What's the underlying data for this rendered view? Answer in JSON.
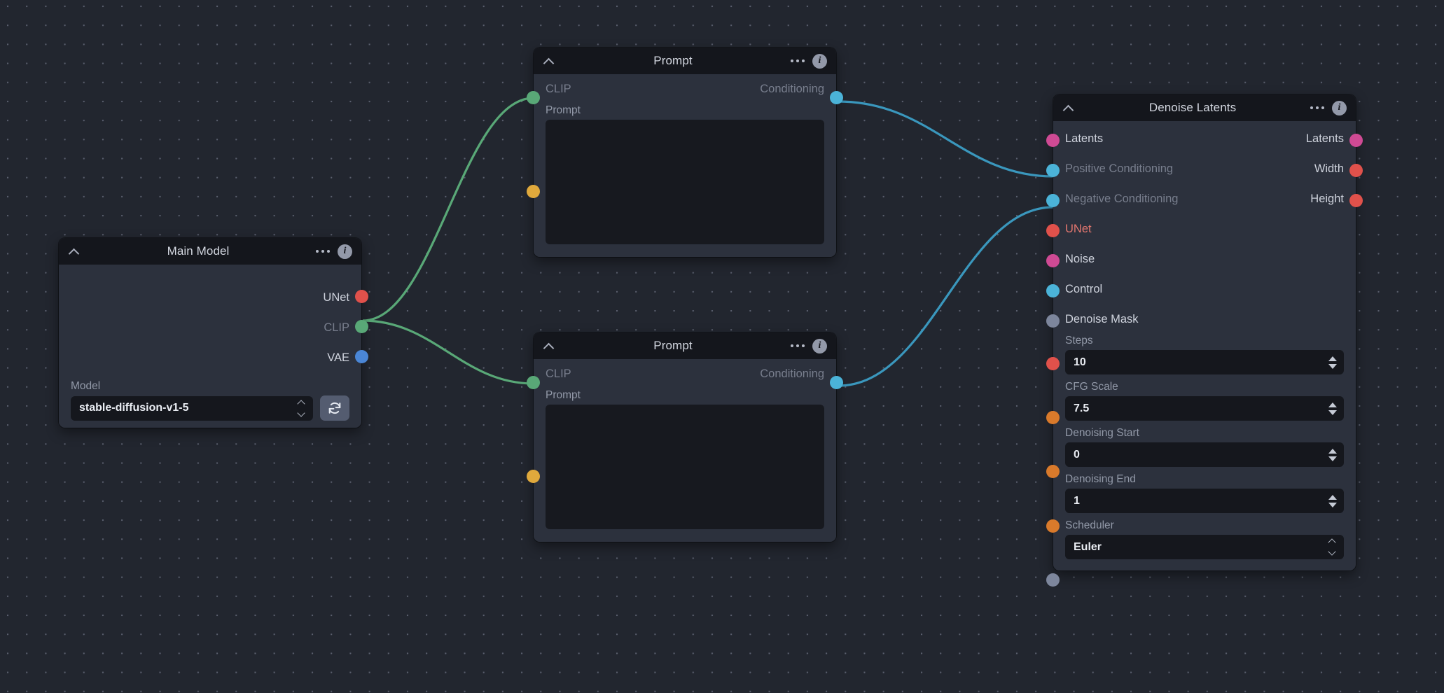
{
  "canvas": {
    "background_color": "#22262f",
    "dot_color": "#5a5f6e"
  },
  "colors": {
    "unet_red": "#e0514b",
    "clip_green": "#59a877",
    "vae_blue": "#4a86d6",
    "conditioning_blue": "#4bb3d8",
    "latents_pink": "#cf4a94",
    "prompt_amber": "#e0a93c",
    "mask_grey": "#7d869c",
    "number_orange": "#d97a2b",
    "steps_red": "#e0514b",
    "required_label": "#e3766f"
  },
  "icons": {
    "collapse": "chevron-up-icon",
    "menu": "dots-menu-icon",
    "info": "info-icon",
    "refresh": "refresh-icon",
    "stepper": "stepper-icon",
    "select_chevron": "chevron-up-down-icon"
  },
  "nodes": {
    "main_model": {
      "title": "Main Model",
      "outputs": [
        {
          "label": "UNet",
          "color": "#e0514b",
          "dim": false
        },
        {
          "label": "CLIP",
          "color": "#59a877",
          "dim": true
        },
        {
          "label": "VAE",
          "color": "#4a86d6",
          "dim": false
        }
      ],
      "model_field": {
        "label": "Model",
        "value": "stable-diffusion-v1-5",
        "refresh_title": "Refresh models"
      }
    },
    "prompt_positive": {
      "title": "Prompt",
      "input_label": "CLIP",
      "output_label": "Conditioning",
      "prompt_label": "Prompt",
      "prompt_value": "",
      "prompt_placeholder": ""
    },
    "prompt_negative": {
      "title": "Prompt",
      "input_label": "CLIP",
      "output_label": "Conditioning",
      "prompt_label": "Prompt",
      "prompt_value": "",
      "prompt_placeholder": ""
    },
    "denoise_latents": {
      "title": "Denoise Latents",
      "top_rows": [
        {
          "in_label": "Latents",
          "in_color": "#cf4a94",
          "in_dim": false,
          "in_req": false,
          "out_label": "Latents",
          "out_color": "#cf4a94"
        },
        {
          "in_label": "Positive Conditioning",
          "in_color": "#4bb3d8",
          "in_dim": true,
          "in_req": false,
          "out_label": "Width",
          "out_color": "#e0514b"
        },
        {
          "in_label": "Negative Conditioning",
          "in_color": "#4bb3d8",
          "in_dim": true,
          "in_req": false,
          "out_label": "Height",
          "out_color": "#e0514b"
        }
      ],
      "inputs": [
        {
          "label": "UNet",
          "color": "#e0514b",
          "dim": false,
          "req": true
        },
        {
          "label": "Noise",
          "color": "#cf4a94",
          "dim": false,
          "req": false
        },
        {
          "label": "Control",
          "color": "#4bb3d8",
          "dim": false,
          "req": false
        },
        {
          "label": "Denoise Mask",
          "color": "#7d869c",
          "dim": false,
          "req": false
        }
      ],
      "fields": [
        {
          "label": "Steps",
          "value": "10",
          "type": "number",
          "port_color": "#e0514b"
        },
        {
          "label": "CFG Scale",
          "value": "7.5",
          "type": "number",
          "port_color": "#d97a2b"
        },
        {
          "label": "Denoising Start",
          "value": "0",
          "type": "number",
          "port_color": "#d97a2b"
        },
        {
          "label": "Denoising End",
          "value": "1",
          "type": "number",
          "port_color": "#d97a2b"
        },
        {
          "label": "Scheduler",
          "value": "Euler",
          "type": "select",
          "port_color": "#7d869c"
        }
      ]
    }
  },
  "edges": [
    {
      "from": "main_model.clip",
      "to": "prompt_positive.clip",
      "color": "#59a877"
    },
    {
      "from": "main_model.clip",
      "to": "prompt_negative.clip",
      "color": "#59a877"
    },
    {
      "from": "prompt_positive.conditioning",
      "to": "denoise.positive",
      "color": "#4bb3d8"
    },
    {
      "from": "prompt_negative.conditioning",
      "to": "denoise.negative",
      "color": "#4bb3d8"
    }
  ]
}
